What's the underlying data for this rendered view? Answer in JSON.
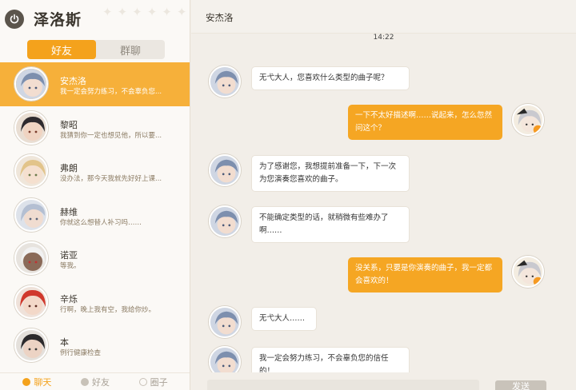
{
  "user": {
    "name": "泽洛斯"
  },
  "tabs": [
    {
      "label": "好友",
      "active": true
    },
    {
      "label": "群聊",
      "active": false
    }
  ],
  "contacts": [
    {
      "name": "安杰洛",
      "preview": "我一定会努力练习，不会辜负您...",
      "avatar": "blue-hair-boy",
      "active": true
    },
    {
      "name": "黎昭",
      "preview": "我猜到你一定也想见他，所以要...",
      "avatar": "dark-hair-boy",
      "active": false
    },
    {
      "name": "弗朗",
      "preview": "没办法，那今天我就先好好上课...",
      "avatar": "blond-hair-man",
      "active": false
    },
    {
      "name": "赫维",
      "preview": "你就这么想替人补习吗……",
      "avatar": "silver-hair-man",
      "active": false
    },
    {
      "name": "诺亚",
      "preview": "等我。",
      "avatar": "white-hair-dark-skin-man",
      "active": false
    },
    {
      "name": "辛烁",
      "preview": "行啊，晚上我有空，我给你炒。",
      "avatar": "red-hair-boy",
      "active": false
    },
    {
      "name": "本",
      "preview": "例行健康检查",
      "avatar": "dark-hair-man",
      "active": false
    }
  ],
  "bottom_nav": [
    {
      "label": "聊天",
      "icon": "chat-icon",
      "active": true
    },
    {
      "label": "好友",
      "icon": "person-icon",
      "active": false
    },
    {
      "label": "圈子",
      "icon": "circle-icon",
      "active": false
    }
  ],
  "chat": {
    "title": "安杰洛",
    "timestamp": "14:22",
    "messages": [
      {
        "from": "other",
        "text": "无弋大人，您喜欢什么类型的曲子呢？"
      },
      {
        "from": "self",
        "text": "一下不太好描述啊……说起来，怎么忽然问这个？"
      },
      {
        "from": "other",
        "text": "为了感谢您，我想提前准备一下，下一次为您演奏您喜欢的曲子。"
      },
      {
        "from": "other",
        "text": "不能确定类型的话，就稍微有些难办了啊……"
      },
      {
        "from": "self",
        "text": "没关系，只要是你演奏的曲子，我一定都会喜欢的！"
      },
      {
        "from": "other",
        "text": "无弋大人……"
      },
      {
        "from": "other",
        "text": "我一定会努力练习，不会辜负您的信任的！"
      }
    ],
    "send_label": "发送"
  },
  "colors": {
    "accent": "#f5a623",
    "bubble_in": "#ffffff",
    "background": "#f2eee8"
  }
}
